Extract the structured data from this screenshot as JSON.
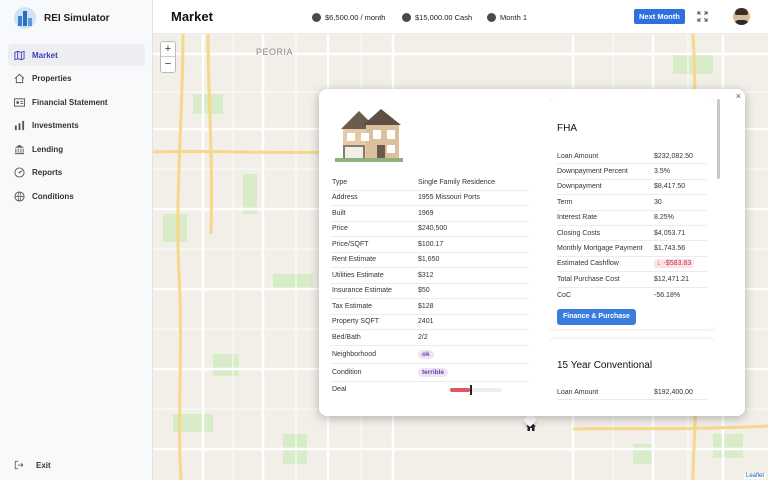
{
  "app": {
    "name": "REI Simulator"
  },
  "sidebar": {
    "items": [
      {
        "label": "Market",
        "icon": "map-icon",
        "active": true
      },
      {
        "label": "Properties",
        "icon": "home-icon"
      },
      {
        "label": "Financial Statement",
        "icon": "statement-icon"
      },
      {
        "label": "Investments",
        "icon": "bar-chart-icon"
      },
      {
        "label": "Lending",
        "icon": "bank-icon"
      },
      {
        "label": "Reports",
        "icon": "reports-icon"
      },
      {
        "label": "Conditions",
        "icon": "globe-icon"
      }
    ],
    "exit_label": "Exit"
  },
  "header": {
    "title": "Market",
    "monthly": "$6,500.00 / month",
    "cash": "$15,000.00 Cash",
    "month": "Month 1",
    "next_label": "Next Month"
  },
  "map": {
    "city_label": "PEORIA",
    "zoom_in": "+",
    "zoom_out": "−",
    "attribution": "Leaflet",
    "close_label": "×"
  },
  "property": {
    "rows": [
      {
        "key": "Type",
        "value": "Single Family Residence"
      },
      {
        "key": "Address",
        "value": "1955 Missouri Ports"
      },
      {
        "key": "Built",
        "value": "1969"
      },
      {
        "key": "Price",
        "value": "$240,500"
      },
      {
        "key": "Price/SQFT",
        "value": "$100.17"
      },
      {
        "key": "Rent Estimate",
        "value": "$1,650"
      },
      {
        "key": "Utilities Estimate",
        "value": "$312"
      },
      {
        "key": "Insurance Estimate",
        "value": "$50"
      },
      {
        "key": "Tax Estimate",
        "value": "$128"
      },
      {
        "key": "Property SQFT",
        "value": "2401"
      },
      {
        "key": "Bed/Bath",
        "value": "2/2"
      }
    ],
    "neighborhood_label": "Neighborhood",
    "neighborhood_value": "ok",
    "condition_label": "Condition",
    "condition_value": "terrible",
    "deal_label": "Deal",
    "deal_fraction": 0.38
  },
  "financing": [
    {
      "title": "FHA",
      "rows": [
        {
          "key": "Loan Amount",
          "value": "$232,082.50"
        },
        {
          "key": "Downpayment Percent",
          "value": "3.5%"
        },
        {
          "key": "Downpayment",
          "value": "$8,417.50"
        },
        {
          "key": "Term",
          "value": "30"
        },
        {
          "key": "Interest Rate",
          "value": "8.25%"
        },
        {
          "key": "Closing Costs",
          "value": "$4,053.71"
        },
        {
          "key": "Monthly Mortgage Payment",
          "value": "$1,743.56"
        }
      ],
      "cashflow_label": "Estimated Cashflow",
      "cashflow_value": "-$583.83",
      "rows2": [
        {
          "key": "Total Purchase Cost",
          "value": "$12,471.21"
        },
        {
          "key": "CoC",
          "value": "-56.18%"
        }
      ],
      "button_label": "Finance & Purchase"
    },
    {
      "title": "15 Year Conventional",
      "rows": [
        {
          "key": "Loan Amount",
          "value": "$192,400.00"
        }
      ]
    }
  ],
  "colors": {
    "accent": "#2f6fe0",
    "active_nav": "#3a3fb8",
    "negative": "#c0303e"
  }
}
